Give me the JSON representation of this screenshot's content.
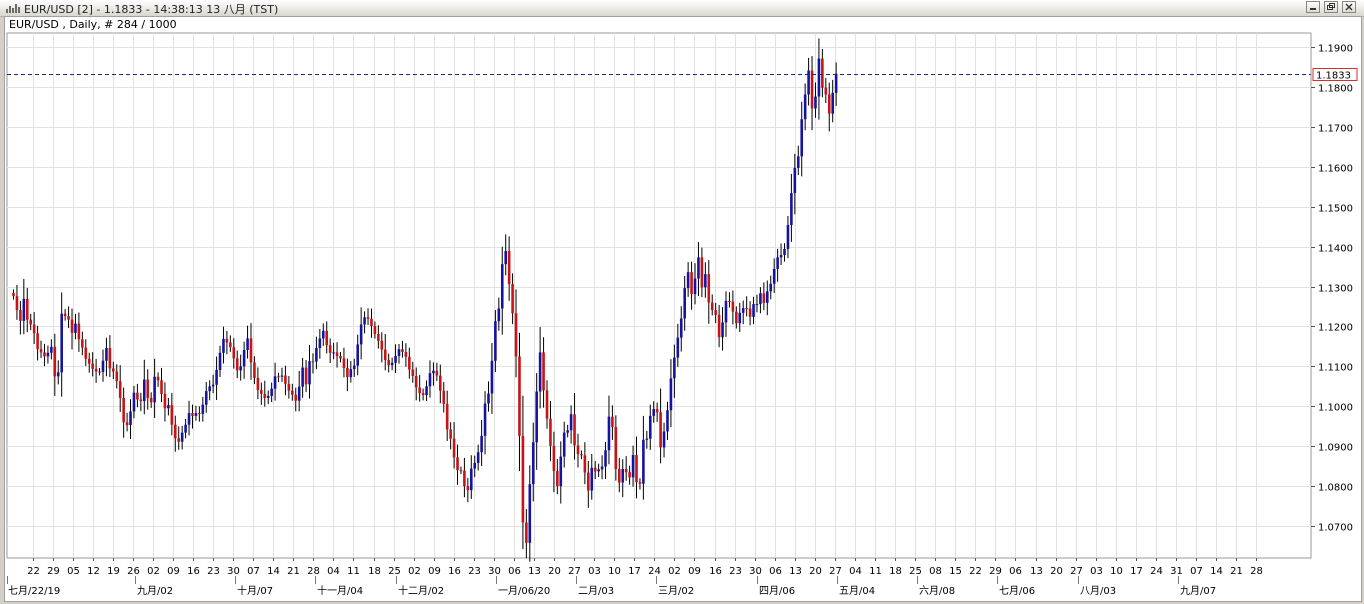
{
  "window": {
    "title": "EUR/USD [2] - 1.1833 - 14:38:13  13 八月 (TST)",
    "buttons": [
      "minimize",
      "restore",
      "close"
    ]
  },
  "chart_info": "EUR/USD , Daily, # 284 / 1000",
  "colors": {
    "up": "#1414a0",
    "down": "#c81414",
    "grid": "#e2e2e2",
    "price_line": "#1a2a7a",
    "price_box": "#d03030"
  },
  "chart_data": {
    "type": "candlestick",
    "symbol": "EUR/USD",
    "timeframe": "Daily",
    "current_price": 1.1833,
    "current_price_label": "1.1833",
    "ylim": [
      1.062,
      1.1935
    ],
    "y_ticks": [
      "1.0700",
      "1.0800",
      "1.0900",
      "1.1000",
      "1.1100",
      "1.1200",
      "1.1300",
      "1.1400",
      "1.1500",
      "1.1600",
      "1.1700",
      "1.1800",
      "1.1900"
    ],
    "x_ticks": [
      "22",
      "29",
      "05",
      "12",
      "19",
      "26",
      "02",
      "09",
      "16",
      "23",
      "30",
      "07",
      "14",
      "21",
      "28",
      "04",
      "11",
      "18",
      "25",
      "02",
      "09",
      "16",
      "23",
      "30",
      "06",
      "13",
      "20",
      "27",
      "03",
      "10",
      "17",
      "24",
      "02",
      "09",
      "16",
      "23",
      "30",
      "06",
      "13",
      "20",
      "27",
      "04",
      "11",
      "18",
      "25",
      "08",
      "15",
      "22",
      "29",
      "06",
      "13",
      "20",
      "27",
      "03",
      "10",
      "17",
      "24",
      "31",
      "07",
      "14",
      "21",
      "28"
    ],
    "month_labels": [
      "七月/22/19",
      "九月/02",
      "十月/07",
      "十一月/04",
      "十二月/02",
      "一月/06/20",
      "二月/03",
      "三月/02",
      "四月/06",
      "五月/04",
      "六月/08",
      "七月/06",
      "八月/03",
      "九月/07"
    ],
    "grid": true,
    "closes": [
      1.1276,
      1.1241,
      1.1214,
      1.1269,
      1.1217,
      1.1205,
      1.1183,
      1.1143,
      1.1135,
      1.1125,
      1.1134,
      1.1149,
      1.1075,
      1.1085,
      1.1232,
      1.1226,
      1.1217,
      1.1184,
      1.1207,
      1.1168,
      1.1147,
      1.1119,
      1.1107,
      1.1094,
      1.1087,
      1.1086,
      1.1114,
      1.1146,
      1.1095,
      1.1087,
      1.1063,
      1.1021,
      1.096,
      1.0953,
      1.0987,
      1.1034,
      1.1017,
      1.1013,
      1.1067,
      1.1021,
      1.101,
      1.1074,
      1.1065,
      1.1031,
      1.0995,
      1.1003,
      1.0954,
      1.092,
      1.0911,
      1.0934,
      1.0954,
      1.0983,
      1.0976,
      1.0983,
      1.0981,
      1.1004,
      1.1038,
      1.105,
      1.1054,
      1.1091,
      1.1134,
      1.1169,
      1.116,
      1.1148,
      1.112,
      1.109,
      1.11,
      1.1141,
      1.117,
      1.111,
      1.1071,
      1.1041,
      1.1031,
      1.1021,
      1.1026,
      1.1044,
      1.1075,
      1.1074,
      1.1077,
      1.1056,
      1.1039,
      1.1029,
      1.1014,
      1.1049,
      1.1097,
      1.1055,
      1.1113,
      1.1112,
      1.1146,
      1.117,
      1.1189,
      1.1153,
      1.1134,
      1.1135,
      1.1126,
      1.112,
      1.1096,
      1.1073,
      1.1093,
      1.1102,
      1.1155,
      1.1205,
      1.1223,
      1.1219,
      1.1201,
      1.1181,
      1.1164,
      1.1142,
      1.1116,
      1.1103,
      1.1109,
      1.1126,
      1.1143,
      1.1136,
      1.1124,
      1.1092,
      1.1076,
      1.1047,
      1.1033,
      1.1028,
      1.105,
      1.1083,
      1.1089,
      1.1077,
      1.1039,
      1.1006,
      1.0942,
      1.0919,
      1.0872,
      1.084,
      1.0839,
      1.08,
      1.079,
      1.0844,
      1.0858,
      1.0885,
      1.0926,
      1.1007,
      1.1032,
      1.1114,
      1.1213,
      1.1245,
      1.1356,
      1.1389,
      1.1306,
      1.1233,
      1.1125,
      1.0926,
      1.0709,
      1.0658,
      1.0805,
      1.091,
      1.1037,
      1.1135,
      1.104,
      1.0969,
      1.0901,
      1.0838,
      1.08,
      1.0874,
      1.0934,
      1.094,
      1.098,
      1.0902,
      1.088,
      1.0877,
      1.0834,
      1.0789,
      1.0846,
      1.0837,
      1.0842,
      1.0849,
      1.089,
      1.0974,
      1.0948,
      1.0843,
      1.0809,
      1.0843,
      1.0835,
      1.0822,
      1.0878,
      1.081,
      1.0806,
      1.0916,
      1.0919,
      1.0976,
      1.0993,
      1.0985,
      1.0897,
      1.0937,
      1.099,
      1.107,
      1.1122,
      1.1172,
      1.122,
      1.1296,
      1.1336,
      1.1281,
      1.132,
      1.1373,
      1.1298,
      1.1331,
      1.126,
      1.1241,
      1.1229,
      1.1173,
      1.121,
      1.1264,
      1.1262,
      1.1237,
      1.1208,
      1.1234,
      1.1246,
      1.1245,
      1.1224,
      1.1256,
      1.1256,
      1.1283,
      1.1259,
      1.1288,
      1.1307,
      1.1344,
      1.1373,
      1.1379,
      1.1394,
      1.1454,
      1.1534,
      1.1597,
      1.1626,
      1.1719,
      1.1781,
      1.1841,
      1.1746,
      1.1776,
      1.1871,
      1.1798,
      1.1781,
      1.1733,
      1.1785,
      1.1833
    ]
  }
}
